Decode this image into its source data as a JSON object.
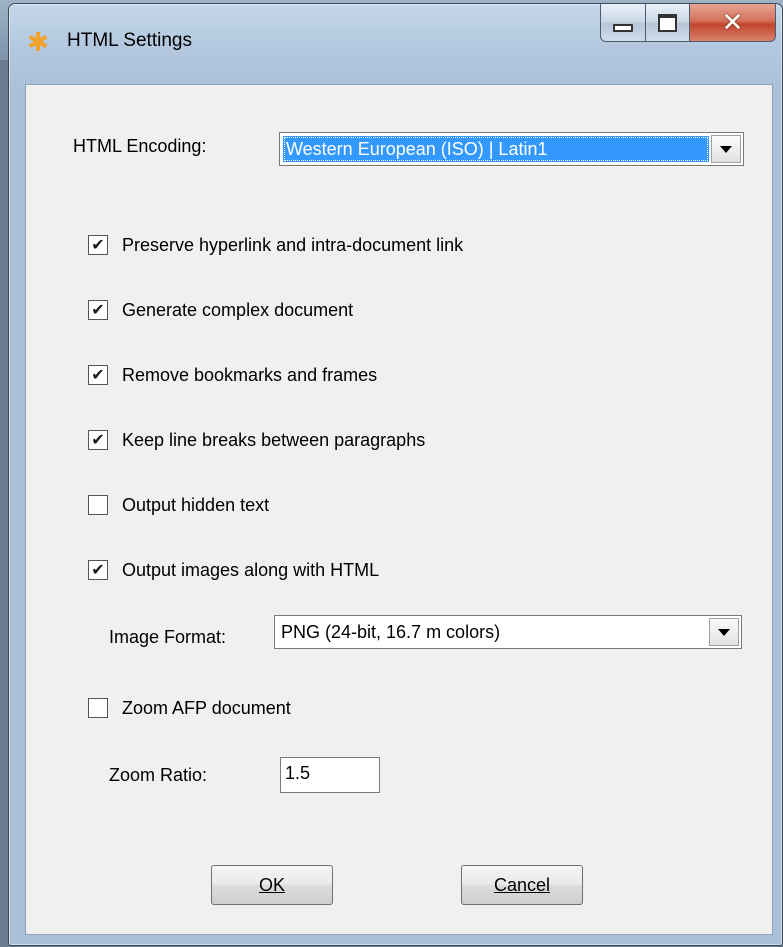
{
  "window": {
    "title": "HTML Settings",
    "icon": "asterisk-app-icon"
  },
  "caption_buttons": {
    "minimize": "minimize-icon",
    "maximize": "maximize-icon",
    "close": "close-icon"
  },
  "encoding": {
    "label": "HTML Encoding:",
    "value": "Western European (ISO) | Latin1"
  },
  "options": [
    {
      "label": "Preserve hyperlink and intra-document link",
      "checked": true
    },
    {
      "label": "Generate complex document",
      "checked": true
    },
    {
      "label": "Remove bookmarks and frames",
      "checked": true
    },
    {
      "label": "Keep line breaks between paragraphs",
      "checked": true
    },
    {
      "label": "Output hidden text",
      "checked": false
    },
    {
      "label": "Output images along with HTML",
      "checked": true
    }
  ],
  "image_format": {
    "label": "Image Format:",
    "value": "PNG (24-bit, 16.7 m colors)"
  },
  "zoom": {
    "checkbox_label": "Zoom AFP document",
    "checked": false,
    "ratio_label": "Zoom Ratio:",
    "ratio_value": "1.5"
  },
  "buttons": {
    "ok": "OK",
    "cancel": "Cancel"
  },
  "colors": {
    "selection": "#3399ff",
    "dialog_bg": "#f0f0f0",
    "close_button": "#c1462c"
  }
}
